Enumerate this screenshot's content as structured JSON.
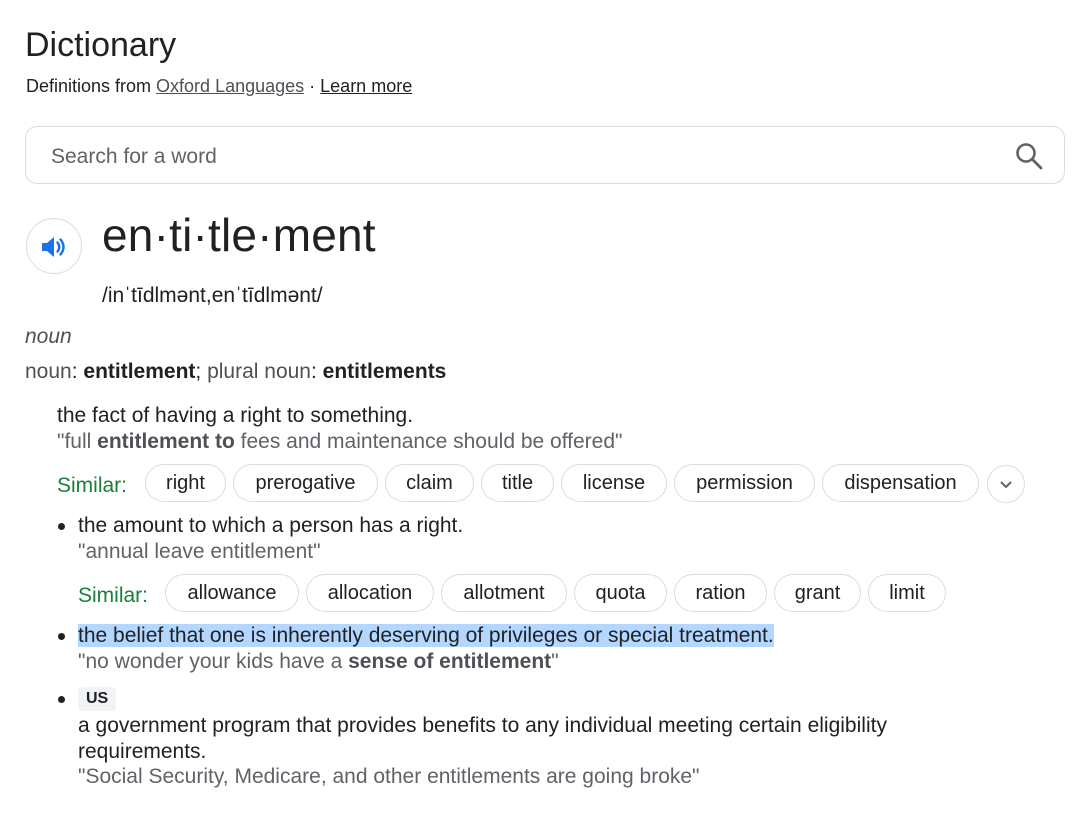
{
  "header": {
    "title": "Dictionary",
    "source_prefix": "Definitions from ",
    "source_link": "Oxford Languages",
    "separator": " · ",
    "learn_more": "Learn more"
  },
  "search": {
    "placeholder": "Search for a word",
    "value": ""
  },
  "entry": {
    "headword": "en·ti·tle·ment",
    "phonetic": "/inˈtīdlmənt,enˈtīdlmənt/",
    "part_of_speech": "noun",
    "forms": {
      "label1": "noun",
      "colon1": ": ",
      "form1": "entitlement",
      "sep": "; ",
      "label2": "plural noun",
      "colon2": ": ",
      "form2": "entitlements"
    }
  },
  "senses": [
    {
      "definition": "the fact of having a right to something.",
      "example_pre": "\"full ",
      "example_bold": "entitlement to",
      "example_post": " fees and maintenance should be offered\"",
      "similar_label": "Similar:",
      "similar": [
        "right",
        "prerogative",
        "claim",
        "title",
        "license",
        "permission",
        "dispensation"
      ]
    },
    {
      "definition": "the amount to which a person has a right.",
      "example": "\"annual leave entitlement\"",
      "similar_label": "Similar:",
      "similar": [
        "allowance",
        "allocation",
        "allotment",
        "quota",
        "ration",
        "grant",
        "limit"
      ]
    },
    {
      "definition": "the belief that one is inherently deserving of privileges or special treatment.",
      "example_pre": "\"no wonder your kids have a ",
      "example_bold": "sense of entitlement",
      "example_post": "\""
    },
    {
      "region": "US",
      "definition_line1": "a government program that provides benefits to any individual meeting certain eligibility",
      "definition_line2": "requirements.",
      "example": "\"Social Security, Medicare, and other entitlements are going broke\""
    }
  ],
  "icons": {
    "search": "search-icon",
    "speaker": "speaker-icon",
    "expand": "chevron-down-icon"
  },
  "colors": {
    "similar_label": "#188038",
    "speaker": "#1a73e8",
    "highlight": "#b3d7ff"
  }
}
